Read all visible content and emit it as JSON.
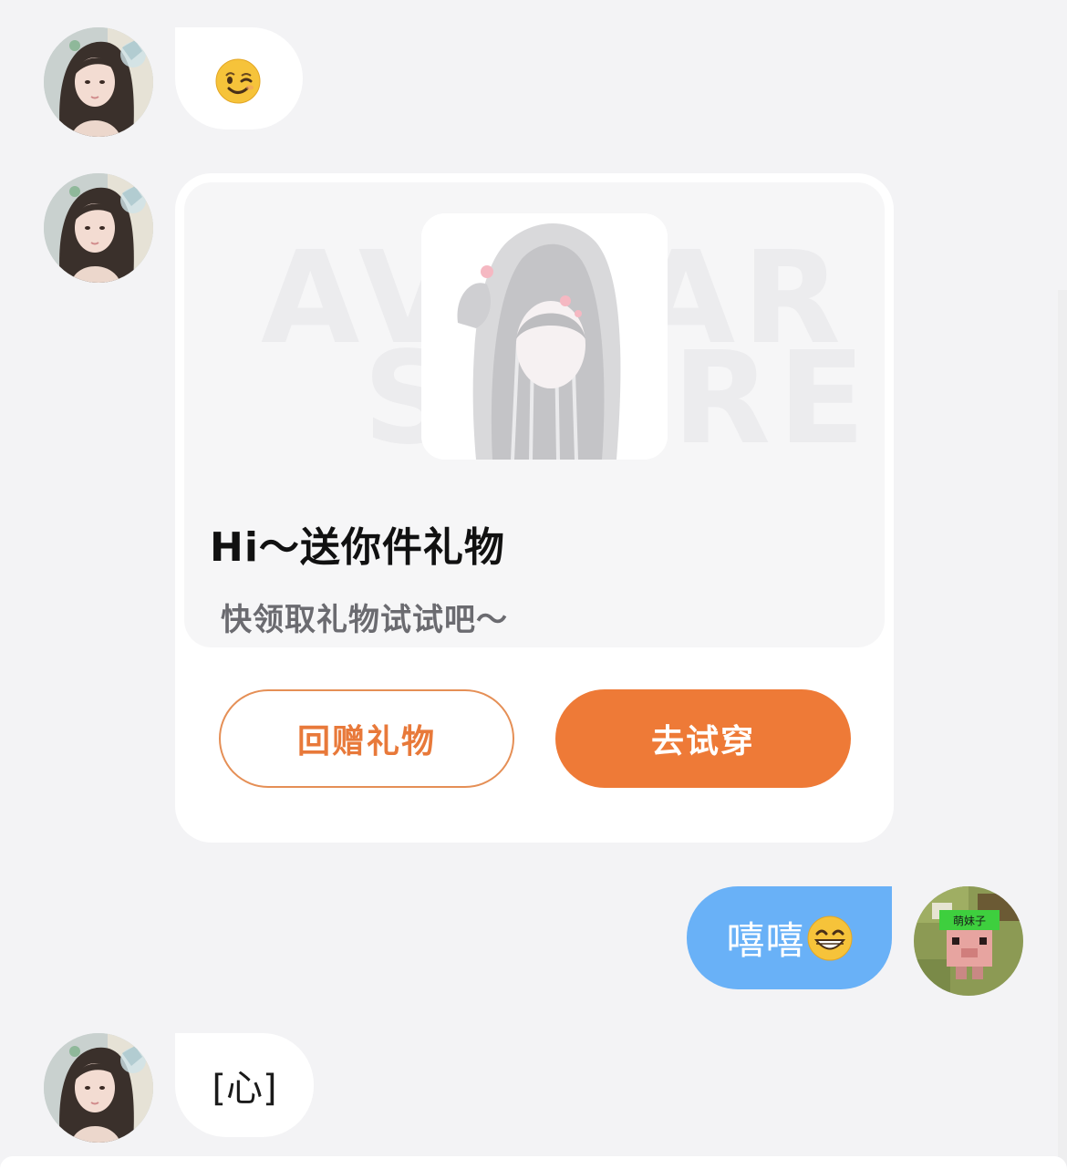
{
  "messages": [
    {
      "sender": "other",
      "type": "emoji",
      "emoji": "winking-face"
    },
    {
      "sender": "other",
      "type": "gift_card",
      "banner_watermark_line1": "AVATAR",
      "banner_watermark_line2": "STORE",
      "title": "Hi～送你件礼物",
      "subtitle": "快领取礼物试试吧～",
      "button_return": "回赠礼物",
      "button_try": "去试穿"
    },
    {
      "sender": "me",
      "type": "text",
      "text": "嘻嘻",
      "emoji": "grinning-face"
    },
    {
      "sender": "other",
      "type": "text",
      "text": "[心]"
    }
  ],
  "my_avatar_label": "萌妹子",
  "colors": {
    "accent_orange": "#ee7a37",
    "my_bubble_blue": "#69b1f7",
    "background": "#f3f3f5"
  }
}
